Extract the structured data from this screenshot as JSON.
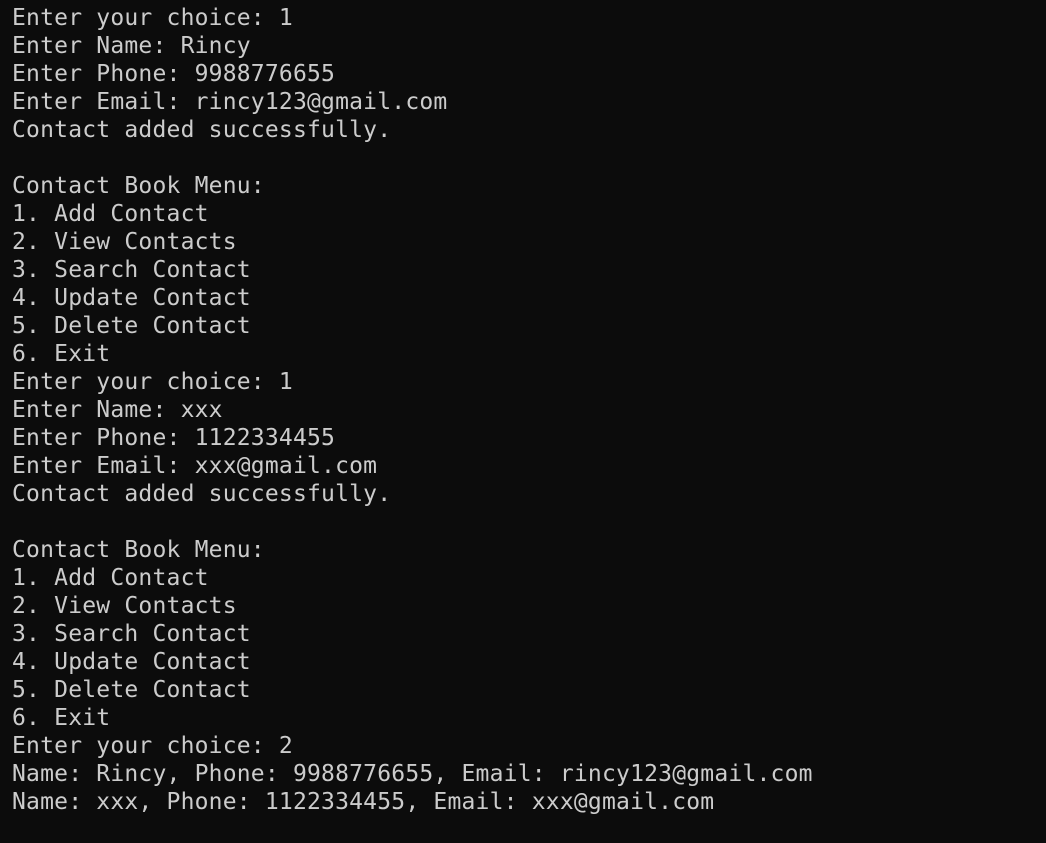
{
  "terminal": {
    "lines": [
      "Enter your choice: 1",
      "Enter Name: Rincy",
      "Enter Phone: 9988776655",
      "Enter Email: rincy123@gmail.com",
      "Contact added successfully.",
      "",
      "Contact Book Menu:",
      "1. Add Contact",
      "2. View Contacts",
      "3. Search Contact",
      "4. Update Contact",
      "5. Delete Contact",
      "6. Exit",
      "Enter your choice: 1",
      "Enter Name: xxx",
      "Enter Phone: 1122334455",
      "Enter Email: xxx@gmail.com",
      "Contact added successfully.",
      "",
      "Contact Book Menu:",
      "1. Add Contact",
      "2. View Contacts",
      "3. Search Contact",
      "4. Update Contact",
      "5. Delete Contact",
      "6. Exit",
      "Enter your choice: 2",
      "Name: Rincy, Phone: 9988776655, Email: rincy123@gmail.com",
      "Name: xxx, Phone: 1122334455, Email: xxx@gmail.com"
    ]
  }
}
